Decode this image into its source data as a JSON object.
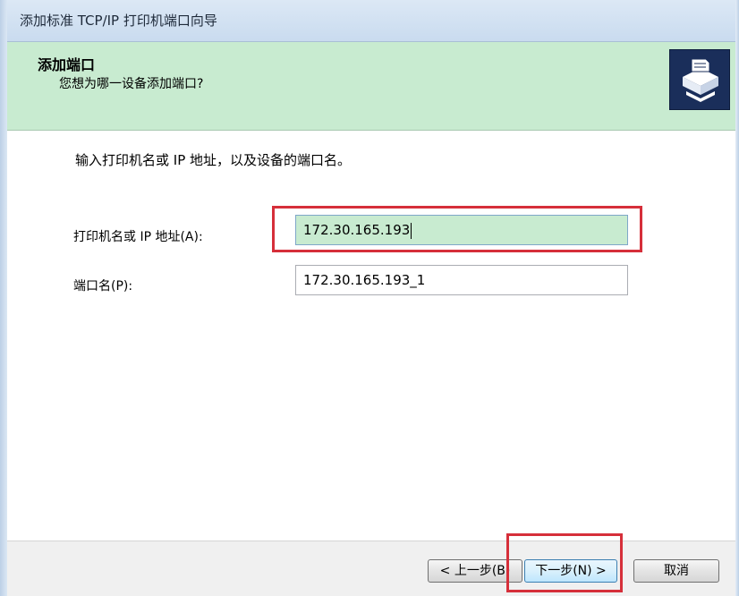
{
  "window": {
    "title": "添加标准 TCP/IP 打印机端口向导"
  },
  "header": {
    "title": "添加端口",
    "subtitle": "您想为哪一设备添加端口?",
    "icon": "printer-port-icon"
  },
  "content": {
    "instruction": "输入打印机名或 IP 地址，以及设备的端口名。",
    "host_field": {
      "label": "打印机名或 IP 地址(A):",
      "value": "172.30.165.193"
    },
    "port_field": {
      "label": "端口名(P):",
      "value": "172.30.165.193_1"
    }
  },
  "footer": {
    "back_label": "< 上一步(B)",
    "next_label": "下一步(N) >",
    "cancel_label": "取消"
  },
  "colors": {
    "header_bg": "#c8ebd0",
    "highlight": "#d62f3a",
    "icon_bg": "#1a2e5a"
  }
}
